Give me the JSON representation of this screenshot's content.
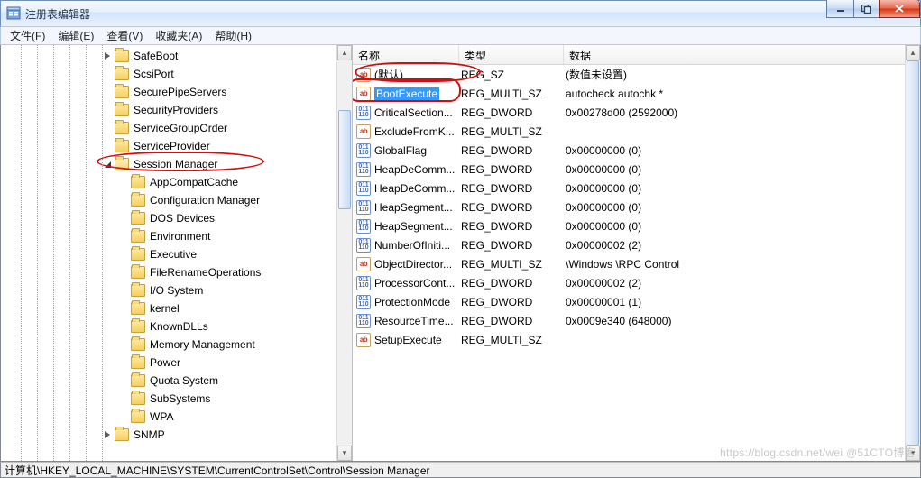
{
  "window": {
    "title": "注册表编辑器"
  },
  "menu": {
    "file": "文件(F)",
    "edit": "编辑(E)",
    "view": "查看(V)",
    "fav": "收藏夹(A)",
    "help": "帮助(H)"
  },
  "tree": {
    "items": [
      {
        "indent": 6,
        "exp": "closed",
        "label": "SafeBoot"
      },
      {
        "indent": 6,
        "exp": "none",
        "label": "ScsiPort"
      },
      {
        "indent": 6,
        "exp": "none",
        "label": "SecurePipeServers"
      },
      {
        "indent": 6,
        "exp": "none",
        "label": "SecurityProviders"
      },
      {
        "indent": 6,
        "exp": "none",
        "label": "ServiceGroupOrder"
      },
      {
        "indent": 6,
        "exp": "none",
        "label": "ServiceProvider"
      },
      {
        "indent": 6,
        "exp": "open",
        "label": "Session Manager",
        "open": true
      },
      {
        "indent": 7,
        "exp": "none",
        "label": "AppCompatCache"
      },
      {
        "indent": 7,
        "exp": "none",
        "label": "Configuration Manager"
      },
      {
        "indent": 7,
        "exp": "none",
        "label": "DOS Devices"
      },
      {
        "indent": 7,
        "exp": "none",
        "label": "Environment"
      },
      {
        "indent": 7,
        "exp": "none",
        "label": "Executive"
      },
      {
        "indent": 7,
        "exp": "none",
        "label": "FileRenameOperations"
      },
      {
        "indent": 7,
        "exp": "none",
        "label": "I/O System"
      },
      {
        "indent": 7,
        "exp": "none",
        "label": "kernel"
      },
      {
        "indent": 7,
        "exp": "none",
        "label": "KnownDLLs"
      },
      {
        "indent": 7,
        "exp": "none",
        "label": "Memory Management"
      },
      {
        "indent": 7,
        "exp": "none",
        "label": "Power"
      },
      {
        "indent": 7,
        "exp": "none",
        "label": "Quota System"
      },
      {
        "indent": 7,
        "exp": "none",
        "label": "SubSystems"
      },
      {
        "indent": 7,
        "exp": "none",
        "label": "WPA"
      },
      {
        "indent": 6,
        "exp": "closed",
        "label": "SNMP"
      }
    ]
  },
  "columns": {
    "name": "名称",
    "type": "类型",
    "data": "数据"
  },
  "values": [
    {
      "icon": "sz",
      "name": "(默认)",
      "type": "REG_SZ",
      "data": "(数值未设置)"
    },
    {
      "icon": "sz",
      "name": "BootExecute",
      "type": "REG_MULTI_SZ",
      "data": "autocheck autochk *",
      "selected": true
    },
    {
      "icon": "bin",
      "name": "CriticalSection...",
      "type": "REG_DWORD",
      "data": "0x00278d00 (2592000)"
    },
    {
      "icon": "sz",
      "name": "ExcludeFromK...",
      "type": "REG_MULTI_SZ",
      "data": ""
    },
    {
      "icon": "bin",
      "name": "GlobalFlag",
      "type": "REG_DWORD",
      "data": "0x00000000 (0)"
    },
    {
      "icon": "bin",
      "name": "HeapDeComm...",
      "type": "REG_DWORD",
      "data": "0x00000000 (0)"
    },
    {
      "icon": "bin",
      "name": "HeapDeComm...",
      "type": "REG_DWORD",
      "data": "0x00000000 (0)"
    },
    {
      "icon": "bin",
      "name": "HeapSegment...",
      "type": "REG_DWORD",
      "data": "0x00000000 (0)"
    },
    {
      "icon": "bin",
      "name": "HeapSegment...",
      "type": "REG_DWORD",
      "data": "0x00000000 (0)"
    },
    {
      "icon": "bin",
      "name": "NumberOfIniti...",
      "type": "REG_DWORD",
      "data": "0x00000002 (2)"
    },
    {
      "icon": "sz",
      "name": "ObjectDirector...",
      "type": "REG_MULTI_SZ",
      "data": "\\Windows \\RPC Control"
    },
    {
      "icon": "bin",
      "name": "ProcessorCont...",
      "type": "REG_DWORD",
      "data": "0x00000002 (2)"
    },
    {
      "icon": "bin",
      "name": "ProtectionMode",
      "type": "REG_DWORD",
      "data": "0x00000001 (1)"
    },
    {
      "icon": "bin",
      "name": "ResourceTime...",
      "type": "REG_DWORD",
      "data": "0x0009e340 (648000)"
    },
    {
      "icon": "sz",
      "name": "SetupExecute",
      "type": "REG_MULTI_SZ",
      "data": ""
    }
  ],
  "status": {
    "path": "计算机\\HKEY_LOCAL_MACHINE\\SYSTEM\\CurrentControlSet\\Control\\Session Manager"
  },
  "watermark": "https://blog.csdn.net/wei   @51CTO博客"
}
